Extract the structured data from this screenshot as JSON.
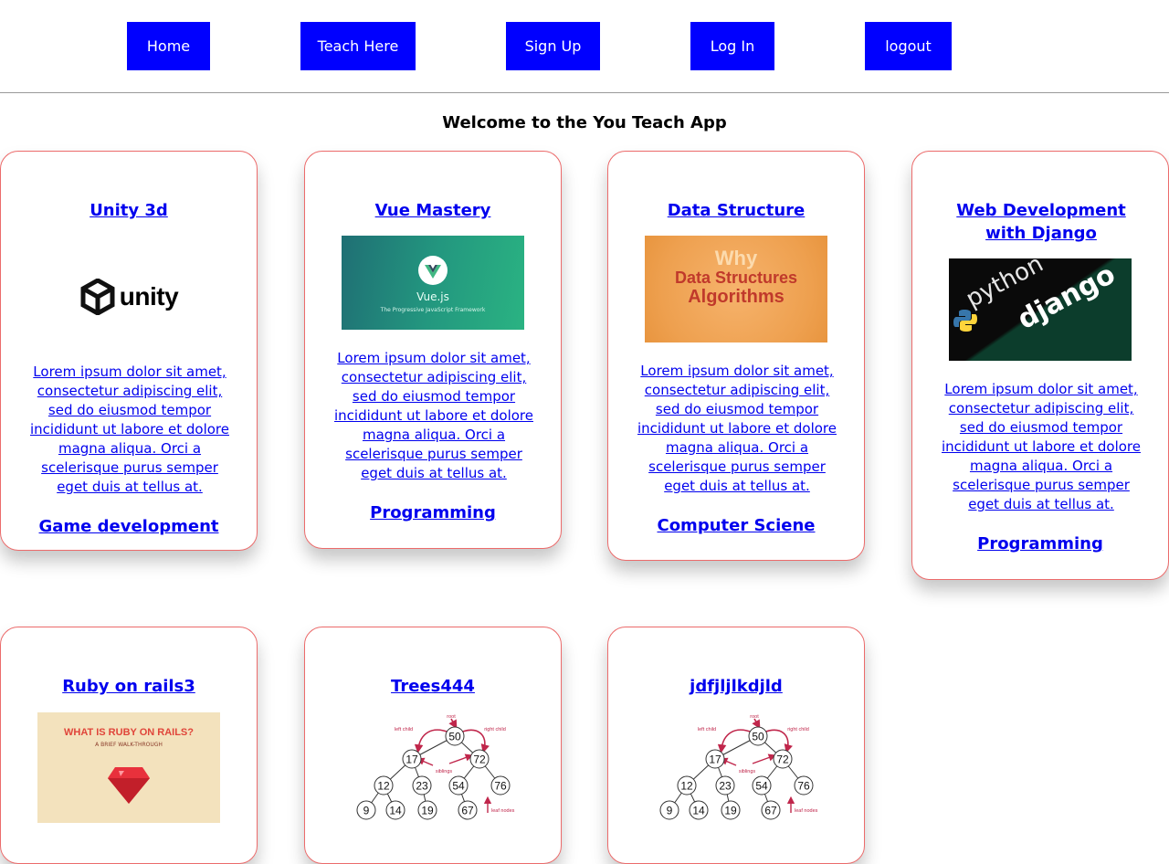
{
  "nav": {
    "items": [
      {
        "label": "Home"
      },
      {
        "label": "Teach Here"
      },
      {
        "label": "Sign Up"
      },
      {
        "label": "Log In"
      },
      {
        "label": "logout"
      }
    ]
  },
  "welcome": "Welcome to the You Teach App",
  "courses": [
    {
      "title": "Unity 3d",
      "image": "unity logo",
      "image_text": "unity",
      "description": "Lorem ipsum dolor sit amet, consectetur adipiscing elit, sed do eiusmod tempor incididunt ut labore et dolore magna aliqua. Orci a scelerisque purus semper eget duis at tellus at.",
      "category": "Game development"
    },
    {
      "title": "Vue Mastery",
      "image": "vue.js banner",
      "image_text": "Vue.js",
      "image_subtext": "The Progressive JavaScript Framework",
      "description": "Lorem ipsum dolor sit amet, consectetur adipiscing elit, sed do eiusmod tempor incididunt ut labore et dolore magna aliqua. Orci a scelerisque purus semper eget duis at tellus at.",
      "category": "Programming"
    },
    {
      "title": "Data Structure",
      "image": "data structures banner",
      "image_text_1": "Why",
      "image_text_2": "Data Structures",
      "image_text_3": "Algorithms",
      "description": "Lorem ipsum dolor sit amet, consectetur adipiscing elit, sed do eiusmod tempor incididunt ut labore et dolore magna aliqua. Orci a scelerisque purus semper eget duis at tellus at.",
      "category": "Computer Sciene"
    },
    {
      "title": "Web Development with Django",
      "image": "python django banner",
      "image_text_1": "python",
      "image_text_2": "django",
      "description": "Lorem ipsum dolor sit amet, consectetur adipiscing elit, sed do eiusmod tempor incididunt ut labore et dolore magna aliqua. Orci a scelerisque purus semper eget duis at tellus at.",
      "category": "Programming"
    },
    {
      "title": "Ruby on rails3",
      "image": "ruby on rails banner",
      "image_text_1": "WHAT IS RUBY ON RAILS?",
      "image_text_2": "A BRIEF WALK-THROUGH"
    },
    {
      "title": "Trees444",
      "image": "binary tree diagram"
    },
    {
      "title": "jdfjljlkdjld",
      "image": "binary tree diagram"
    }
  ],
  "tree_diagram": {
    "nodes": [
      "50",
      "17",
      "72",
      "12",
      "23",
      "54",
      "76",
      "9",
      "14",
      "19",
      "67"
    ],
    "labels": {
      "root": "root",
      "left": "left child",
      "right": "right child",
      "siblings": "siblings",
      "leaf": "leaf nodes"
    }
  },
  "colors": {
    "nav_button": "#0000ff",
    "link": "#0000ee",
    "card_border": "#ec6b6b"
  }
}
